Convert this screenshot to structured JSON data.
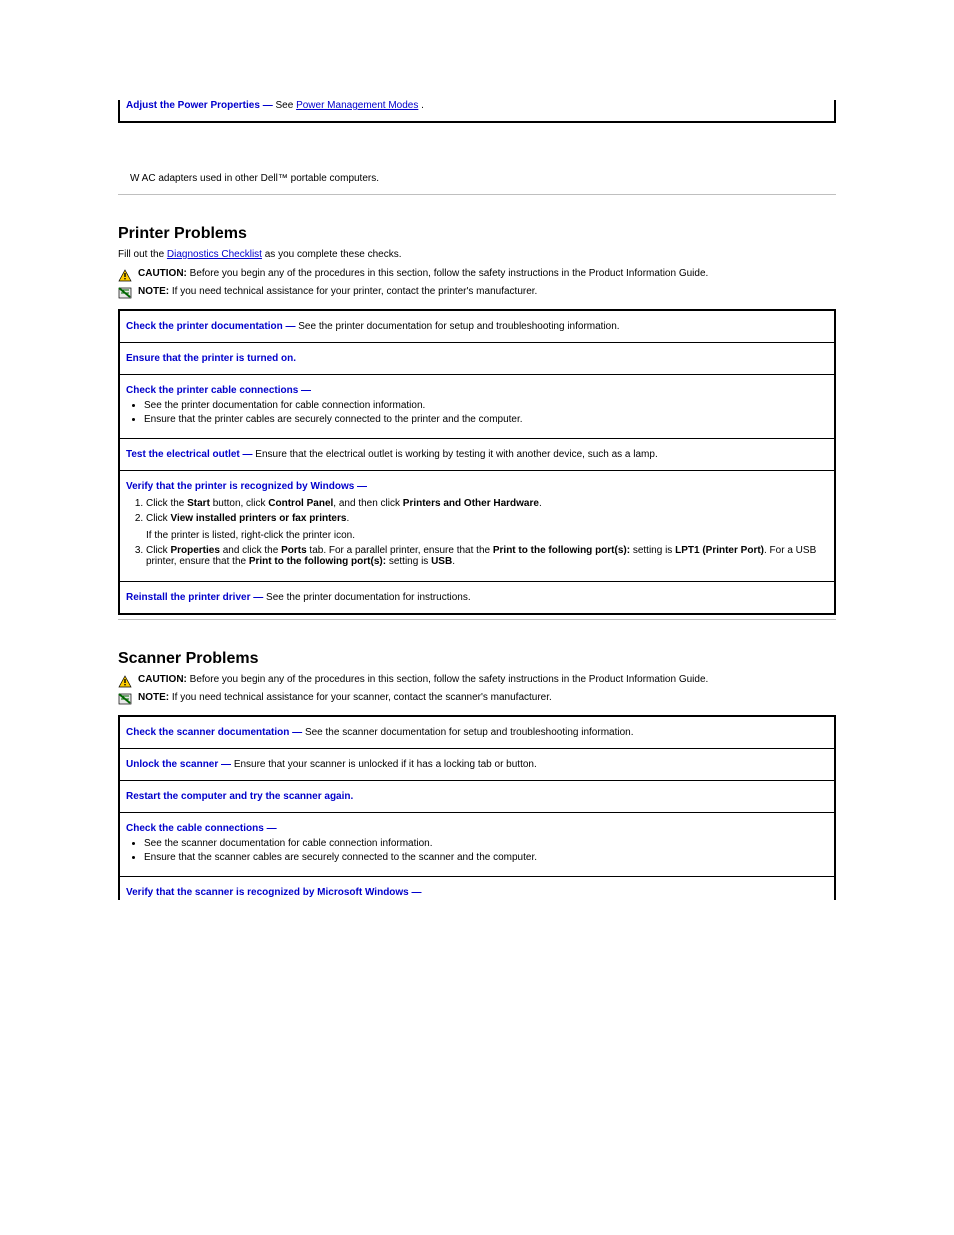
{
  "topbox": {
    "label": "Adjust the Power Properties —",
    "link_intro": " See ",
    "link": "Power Management Modes",
    "period": "."
  },
  "ac_note": "W AC adapters used in other Dell™ portable computers.",
  "printer": {
    "title": "Printer Problems",
    "fill_prefix": "Fill out the ",
    "fill_link": "Diagnostics Checklist",
    "fill_suffix": " as you complete these checks.",
    "caution_label": "CAUTION: ",
    "caution_text": "Before you begin any of the procedures in this section, follow the safety instructions in the Product Information Guide.",
    "note_label": "NOTE: ",
    "note_text": "If you need technical assistance for your printer, contact the printer's manufacturer.",
    "rows": {
      "r0": {
        "title": "Check the printer documentation —",
        "body": " See the printer documentation for setup and troubleshooting information."
      },
      "r1": {
        "title": "Ensure that the printer is turned on."
      },
      "r2_title": "Check the printer cable connections —",
      "r2_b1": "See the printer documentation for cable connection information.",
      "r2_b2": "Ensure that the printer cables are securely connected to the printer and the computer.",
      "r3": {
        "title": "Test the electrical outlet —",
        "body": " Ensure that the electrical outlet is working by testing it with another device, such as a lamp."
      },
      "r4_title": "Verify that the printer is recognized by Windows —",
      "r4_s1a": "Click the ",
      "r4_s1b": "Start",
      "r4_s1c": " button, click ",
      "r4_s1d": "Control Panel",
      "r4_s1e": ", and then click ",
      "r4_s1f": "Printers and Other Hardware",
      "r4_s1g": ".",
      "r4_s2a": "Click ",
      "r4_s2b": "View installed printers or fax printers",
      "r4_s2c": ".",
      "r4_s2_after": "If the printer is listed, right-click the printer icon.",
      "r4_s3a": "Click ",
      "r4_s3b": "Properties",
      "r4_s3c": " and click the ",
      "r4_s3d": "Ports",
      "r4_s3e": " tab. For a parallel printer, ensure that the ",
      "r4_s3f": "Print to the following port(s):",
      "r4_s3g": " setting is ",
      "r4_s3h": "LPT1 (Printer Port)",
      "r4_s3i": ". For a USB printer, ensure that the ",
      "r4_s3j": "Print to the following port(s):",
      "r4_s3k": " setting is ",
      "r4_s3l": "USB",
      "r4_s3m": ".",
      "r5": {
        "title": "Reinstall the printer driver —",
        "body": " See the printer documentation for instructions."
      }
    }
  },
  "scanner": {
    "title": "Scanner Problems",
    "caution_label": "CAUTION: ",
    "caution_text": "Before you begin any of the procedures in this section, follow the safety instructions in the Product Information Guide.",
    "note_label": "NOTE: ",
    "note_text": "If you need technical assistance for your scanner, contact the scanner's manufacturer.",
    "rows": {
      "r0": {
        "title": "Check the scanner documentation —",
        "body": " See the scanner documentation for setup and troubleshooting information."
      },
      "r1": {
        "title": "Unlock the scanner —",
        "body": " Ensure that your scanner is unlocked if it has a locking tab or button."
      },
      "r2": {
        "title": "Restart the computer and try the scanner again."
      },
      "r3_title": "Check the cable connections —",
      "r3_b1": "See the scanner documentation for cable connection information.",
      "r3_b2": "Ensure that the scanner cables are securely connected to the scanner and the computer.",
      "r4_title": "Verify that the scanner is recognized by Microsoft Windows —"
    }
  }
}
